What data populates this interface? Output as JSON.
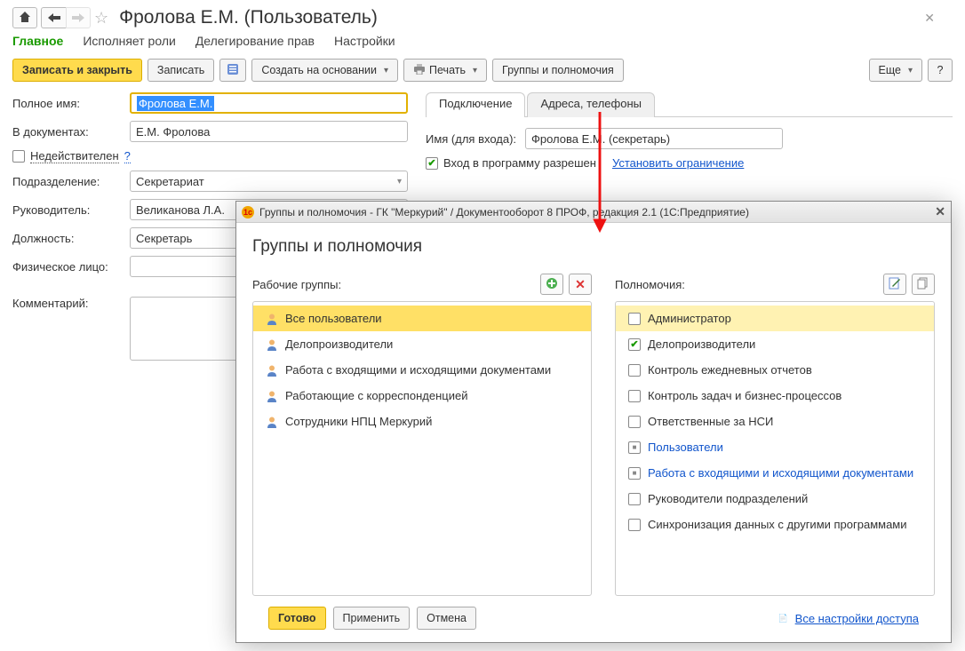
{
  "page_title": "Фролова Е.М. (Пользователь)",
  "subnav": {
    "main": "Главное",
    "roles": "Исполняет роли",
    "deleg": "Делегирование прав",
    "settings": "Настройки"
  },
  "toolbar": {
    "save_close": "Записать и закрыть",
    "save": "Записать",
    "create_based": "Создать на основании",
    "print": "Печать",
    "groups": "Группы и полномочия",
    "more": "Еще",
    "help": "?"
  },
  "fields": {
    "full_name_lbl": "Полное имя:",
    "full_name_val": "Фролова Е.М.",
    "in_docs_lbl": "В документах:",
    "in_docs_val": "Е.М. Фролова",
    "invalid_lbl": "Недействителен",
    "department_lbl": "Подразделение:",
    "department_val": "Секретариат",
    "manager_lbl": "Руководитель:",
    "manager_val": "Великанова Л.А.",
    "position_lbl": "Должность:",
    "position_val": "Секретарь",
    "person_lbl": "Физическое лицо:",
    "comment_lbl": "Комментарий:"
  },
  "right_tabs": {
    "connection": "Подключение",
    "contacts": "Адреса, телефоны"
  },
  "conn": {
    "login_lbl": "Имя (для входа):",
    "login_val": "Фролова Е.М. (секретарь)",
    "allow_lbl": "Вход в программу разрешен",
    "restrict": "Установить ограничение"
  },
  "modal": {
    "title": "Группы и полномочия - ГК \"Меркурий\" / Документооборот 8 ПРОФ, редакция 2.1  (1С:Предприятие)",
    "heading": "Группы и полномочия",
    "groups_lbl": "Рабочие группы:",
    "perms_lbl": "Полномочия:",
    "groups": [
      "Все пользователи",
      "Делопроизводители",
      "Работа с входящими и исходящими документами",
      "Работающие с корреспонденцией",
      "Сотрудники НПЦ Меркурий"
    ],
    "perms": [
      {
        "label": "Администратор",
        "state": "unchecked",
        "link": false
      },
      {
        "label": "Делопроизводители",
        "state": "checked",
        "link": false
      },
      {
        "label": "Контроль ежедневных отчетов",
        "state": "unchecked",
        "link": false
      },
      {
        "label": "Контроль задач и бизнес-процессов",
        "state": "unchecked",
        "link": false
      },
      {
        "label": "Ответственные за НСИ",
        "state": "unchecked",
        "link": false
      },
      {
        "label": "Пользователи",
        "state": "ind",
        "link": true
      },
      {
        "label": "Работа с входящими и исходящими документами",
        "state": "ind",
        "link": true
      },
      {
        "label": "Руководители подразделений",
        "state": "unchecked",
        "link": false
      },
      {
        "label": "Синхронизация данных с другими программами",
        "state": "unchecked",
        "link": false
      }
    ],
    "ready": "Готово",
    "apply": "Применить",
    "cancel": "Отмена",
    "all_settings": "Все настройки доступа"
  }
}
